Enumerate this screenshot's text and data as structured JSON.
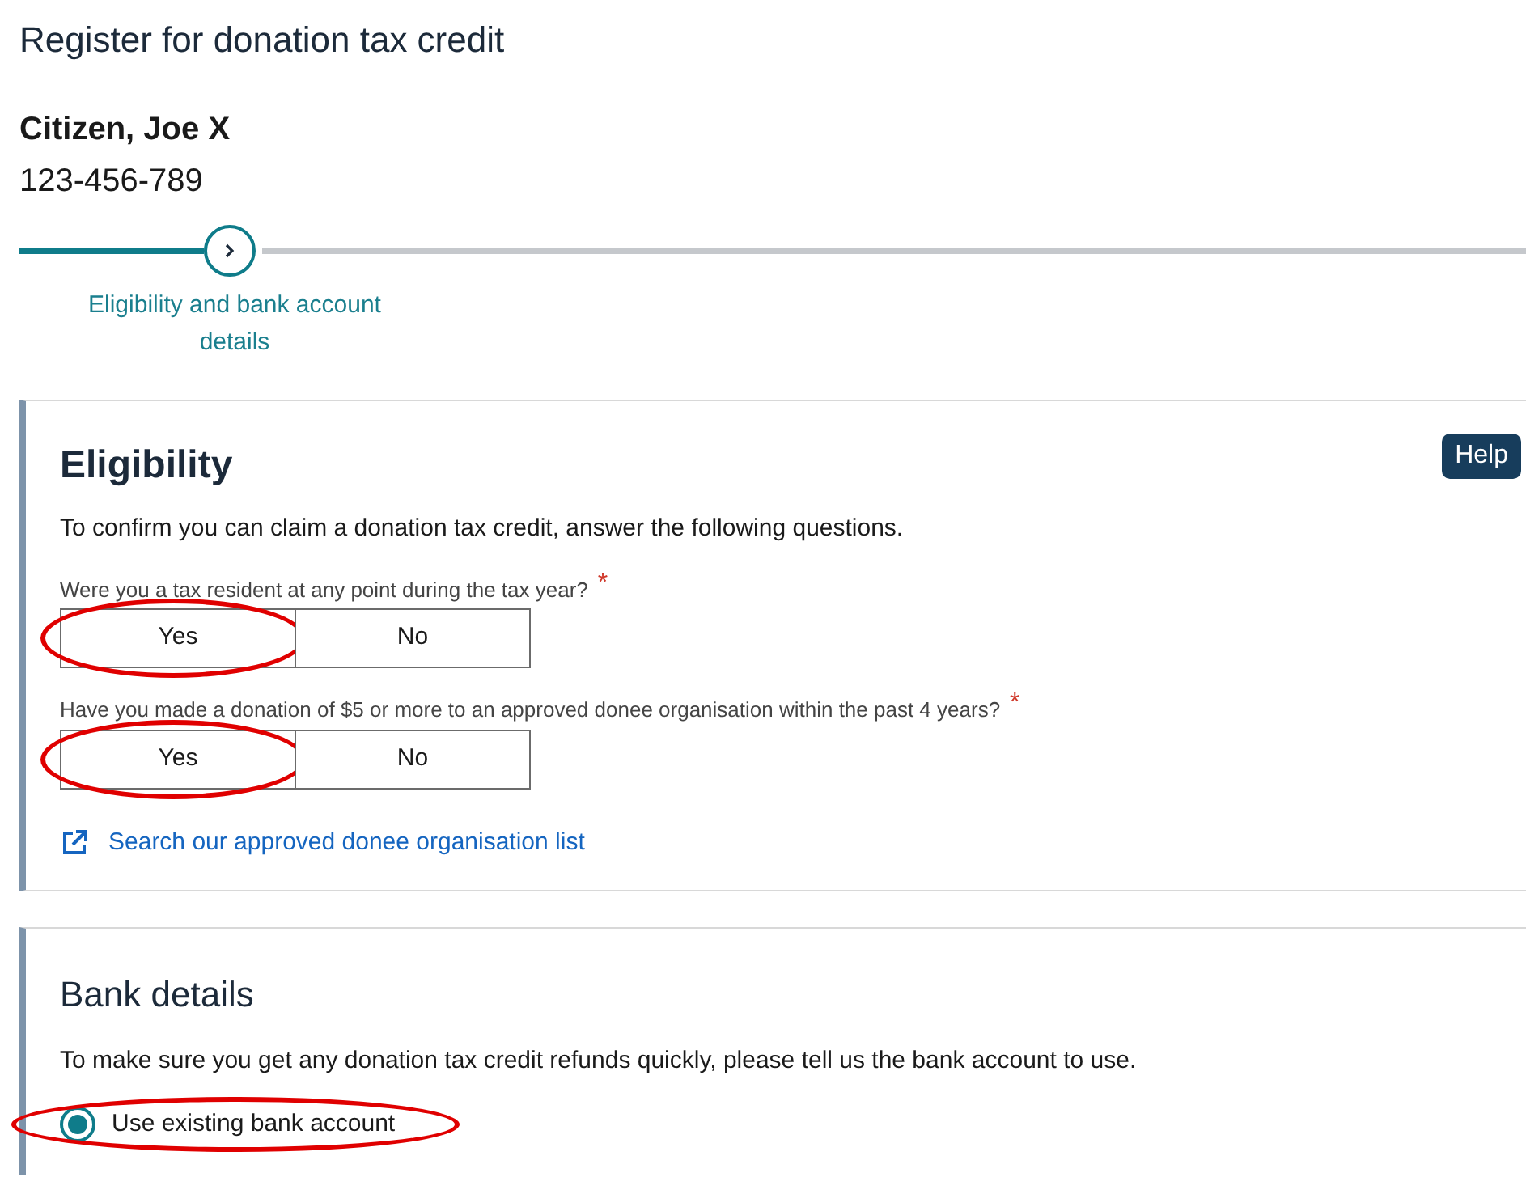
{
  "page_title": "Register for donation tax credit",
  "taxpayer": {
    "name": "Citizen, Joe X",
    "number": "123-456-789"
  },
  "stepper": {
    "steps": [
      {
        "label": "Eligibility and bank account details",
        "selected": true
      }
    ]
  },
  "eligibility": {
    "heading": "Eligibility",
    "help": "Help",
    "intro": "To confirm you can claim a donation tax credit, answer the following questions.",
    "questions": [
      {
        "label": "Were you a tax resident at any point during the tax year?",
        "required_mark": "*",
        "options": [
          {
            "label": "Yes",
            "selected": false,
            "circled": true
          },
          {
            "label": "No",
            "selected": false,
            "circled": false
          }
        ]
      },
      {
        "label": "Have you made a donation of $5 or more to an approved donee organisation within the past 4 years?",
        "required_mark": "*",
        "options": [
          {
            "label": "Yes",
            "selected": false,
            "circled": true
          },
          {
            "label": "No",
            "selected": false,
            "circled": false
          }
        ]
      }
    ],
    "link": "Search our approved donee organisation list"
  },
  "bank_details": {
    "heading": "Bank details",
    "intro": "To make sure you get any donation tax credit refunds quickly, please tell us the bank account to use.",
    "options": [
      {
        "label": "Use existing bank account",
        "checked": true,
        "circled": true
      }
    ]
  }
}
